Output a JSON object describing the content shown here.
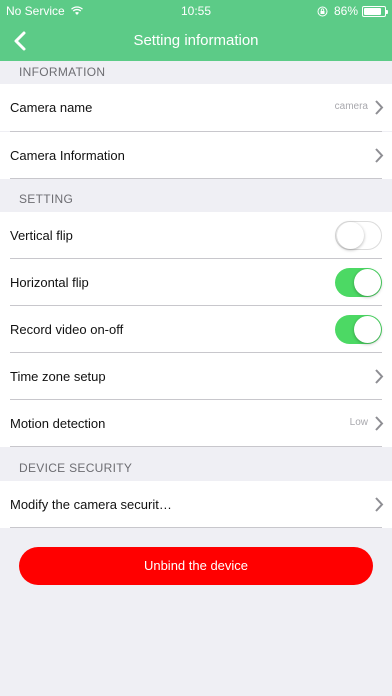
{
  "status": {
    "carrier": "No Service",
    "time": "10:55",
    "battery": "86%",
    "battery_level": 0.86
  },
  "navbar": {
    "back_icon": "chevron-left-icon",
    "title": "Setting information"
  },
  "sections": {
    "information": "INFORMATION",
    "setting": "SETTING",
    "device_security": "DEVICE SECURITY"
  },
  "rows": {
    "camera_name": {
      "label": "Camera name",
      "value": "camera"
    },
    "camera_info": {
      "label": "Camera Information"
    },
    "vertical_flip": {
      "label": "Vertical flip",
      "on": false
    },
    "horizontal_flip": {
      "label": "Horizontal flip",
      "on": true
    },
    "record_video": {
      "label": "Record video on-off",
      "on": true
    },
    "time_zone": {
      "label": "Time zone setup"
    },
    "motion_detection": {
      "label": "Motion detection",
      "value": "Low"
    },
    "modify_security": {
      "label": "Modify the camera securit…"
    }
  },
  "unbind_label": "Unbind the device",
  "colors": {
    "accent": "#5ccb87",
    "toggle_on": "#4cd964",
    "danger": "#ff0000"
  }
}
